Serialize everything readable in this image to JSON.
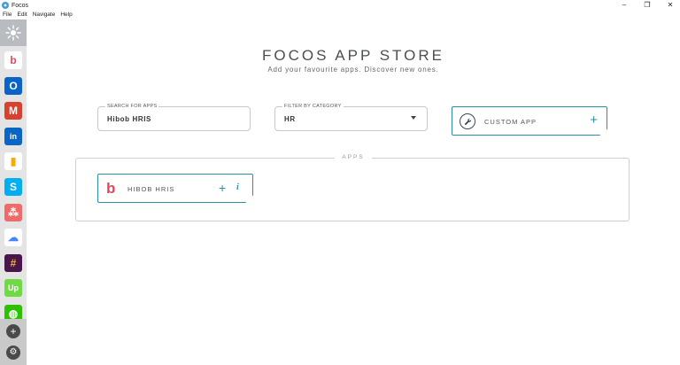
{
  "window": {
    "title": "Focos",
    "controls": {
      "minimize": "–",
      "maximize": "❐",
      "close": "✕"
    }
  },
  "menu": [
    "File",
    "Edit",
    "Navigate",
    "Help"
  ],
  "sidebar": {
    "top_icon": "focos-logo-icon",
    "apps": [
      {
        "name": "hibob",
        "glyph": "b",
        "color": "#e5485a",
        "bg": "#ffffff"
      },
      {
        "name": "outlook",
        "glyph": "O",
        "color": "#ffffff",
        "bg": "#0a64c8"
      },
      {
        "name": "gmail",
        "glyph": "M",
        "color": "#ffffff",
        "bg": "#d8412f"
      },
      {
        "name": "linkedin",
        "glyph": "in",
        "color": "#ffffff",
        "bg": "#0a66c2"
      },
      {
        "name": "google-analytics",
        "glyph": "▮",
        "color": "#f9ab00",
        "bg": "#ffffff"
      },
      {
        "name": "skype",
        "glyph": "S",
        "color": "#ffffff",
        "bg": "#00aff0"
      },
      {
        "name": "asana",
        "glyph": "⁂",
        "color": "#ffffff",
        "bg": "#f06a6a"
      },
      {
        "name": "google-cloud",
        "glyph": "☁",
        "color": "#4285f4",
        "bg": "#ffffff"
      },
      {
        "name": "slack",
        "glyph": "#",
        "color": "#ecb22e",
        "bg": "#4a154b"
      },
      {
        "name": "upwork",
        "glyph": "Up",
        "color": "#ffffff",
        "bg": "#6fda44"
      },
      {
        "name": "wechat",
        "glyph": "◍",
        "color": "#ffffff",
        "bg": "#2dc100"
      }
    ],
    "add_label": "+",
    "settings_label": "⚙"
  },
  "store": {
    "title": "FOCOS APP STORE",
    "subtitle": "Add your favourite apps. Discover new ones."
  },
  "search": {
    "label": "SEARCH FOR APPS",
    "value": "Hibob HRIS"
  },
  "filter": {
    "label": "FILTER BY CATEGORY",
    "value": "HR"
  },
  "custom_app": {
    "label": "CUSTOM APP",
    "icon": "🔧",
    "plus": "+"
  },
  "apps_section": {
    "legend": "APPS",
    "items": [
      {
        "logo": "b",
        "name": "HIBOB HRIS",
        "add": "+",
        "info": "i"
      }
    ]
  }
}
